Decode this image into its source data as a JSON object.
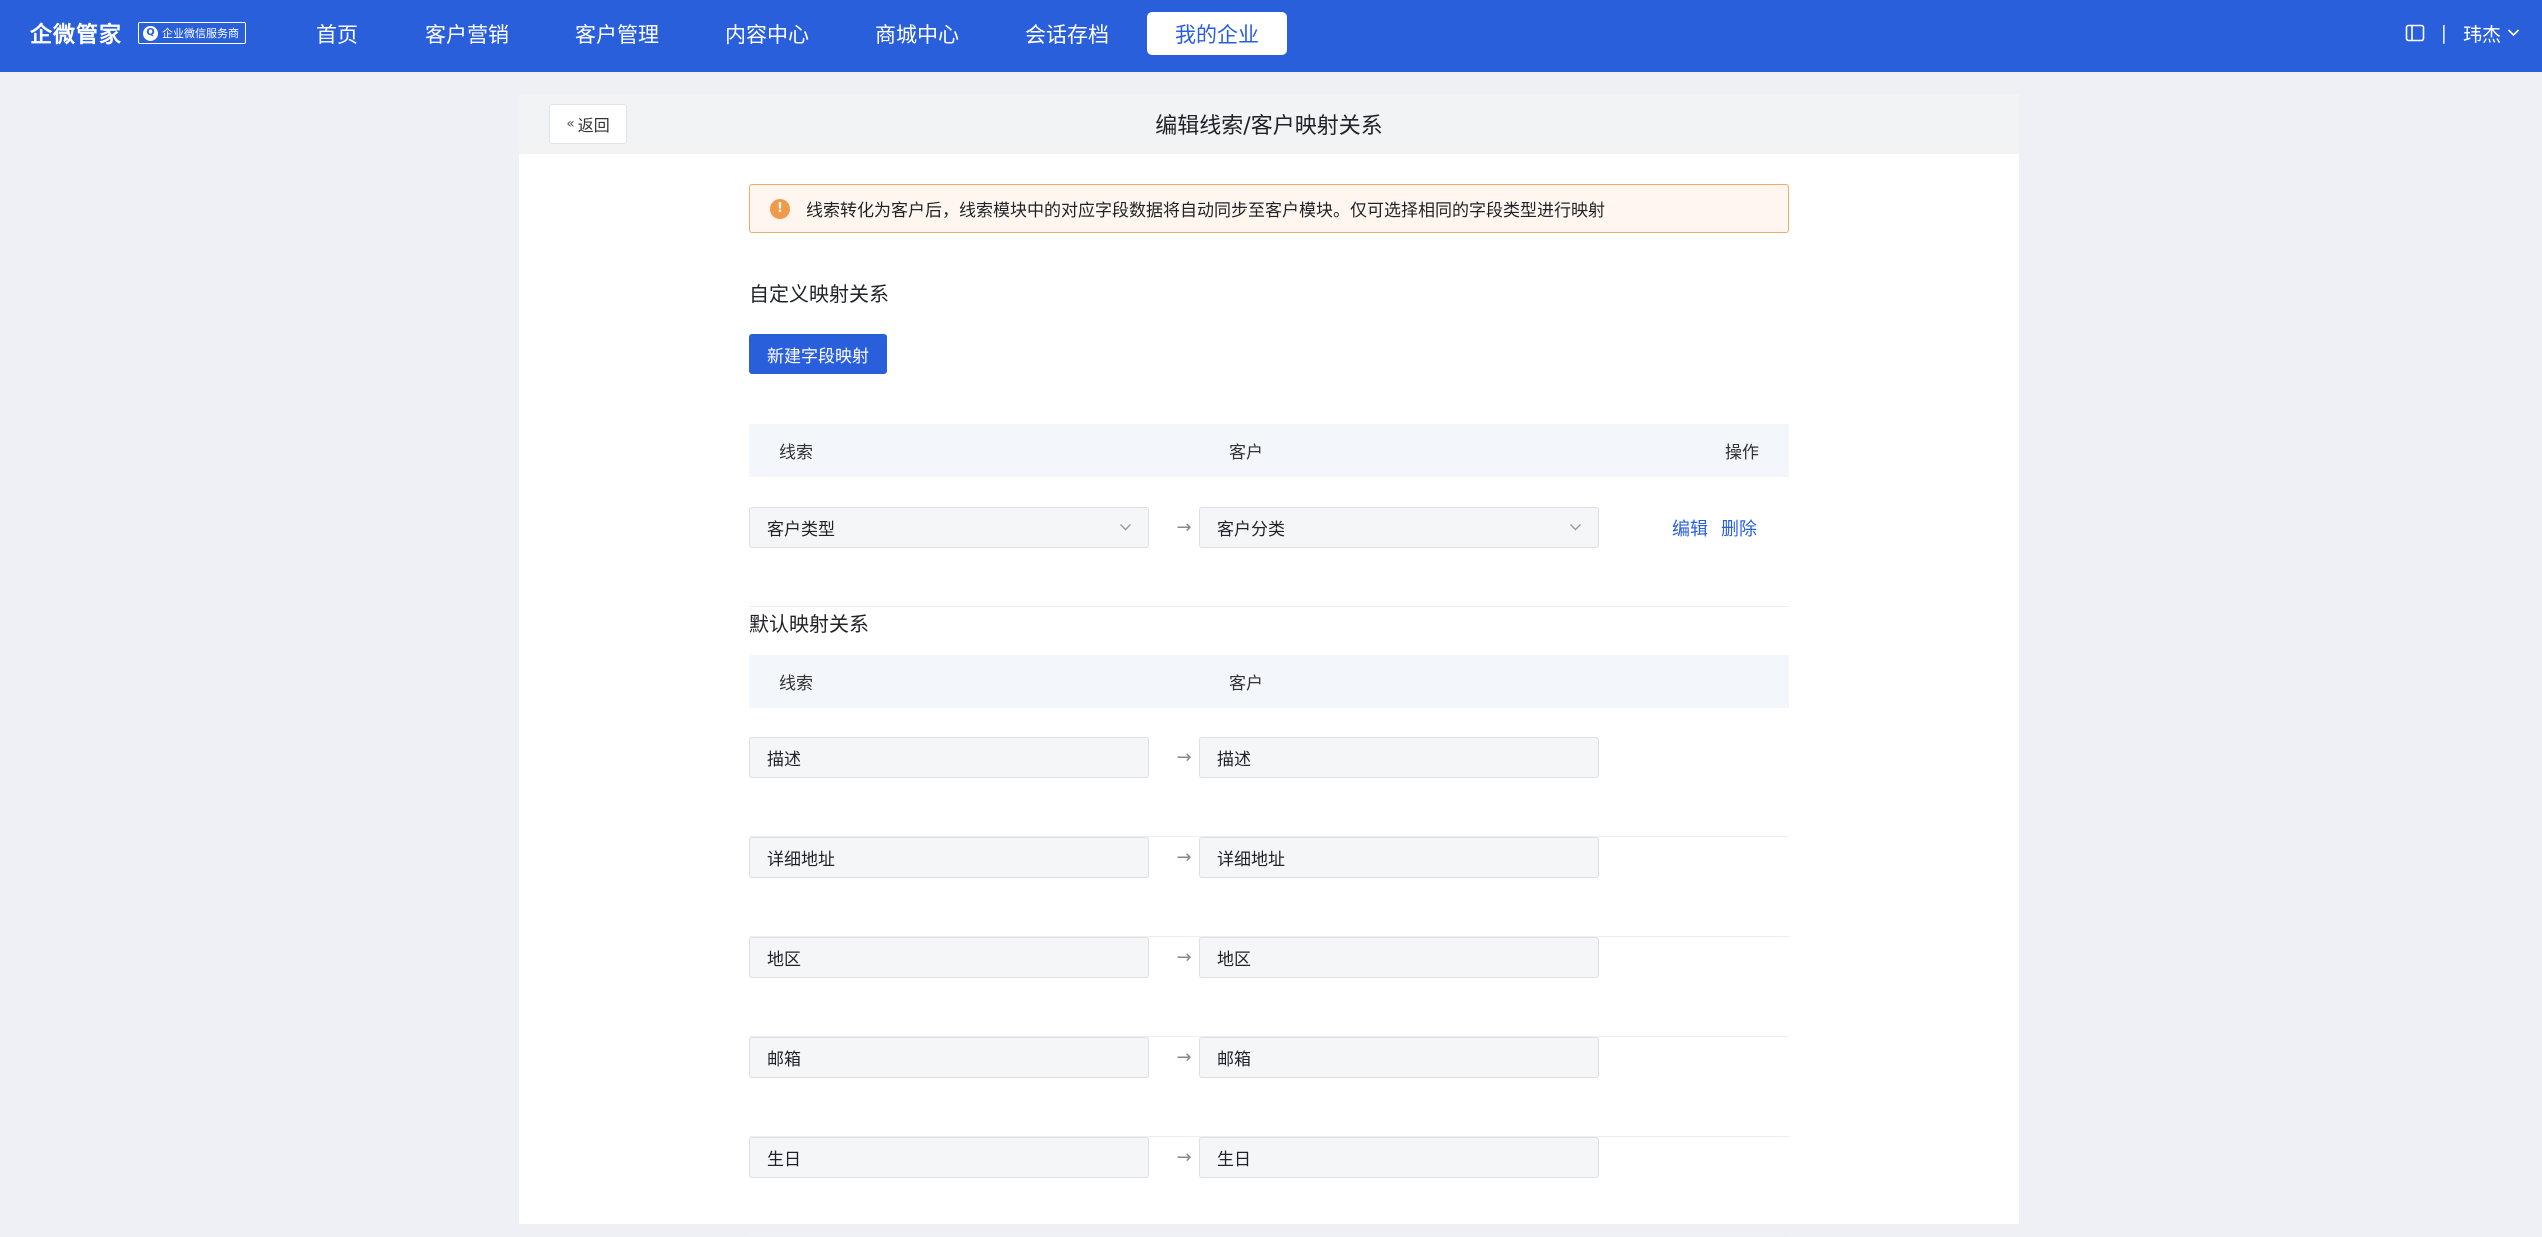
{
  "brand": {
    "name": "企微管家",
    "badge": "企业微信服务商"
  },
  "nav": {
    "items": [
      {
        "label": "首页"
      },
      {
        "label": "客户营销"
      },
      {
        "label": "客户管理"
      },
      {
        "label": "内容中心"
      },
      {
        "label": "商城中心"
      },
      {
        "label": "会话存档"
      },
      {
        "label": "我的企业",
        "active": true
      }
    ]
  },
  "user": {
    "divider": "|",
    "name": "玮杰"
  },
  "header": {
    "back_label": "返回",
    "title": "编辑线索/客户映射关系"
  },
  "alert": {
    "text": "线索转化为客户后，线索模块中的对应字段数据将自动同步至客户模块。仅可选择相同的字段类型进行映射"
  },
  "custom": {
    "title": "自定义映射关系",
    "new_button": "新建字段映射",
    "columns": {
      "lead": "线索",
      "customer": "客户",
      "action": "操作"
    },
    "rows": [
      {
        "lead": "客户类型",
        "customer": "客户分类",
        "edit": "编辑",
        "delete": "删除"
      }
    ]
  },
  "default": {
    "title": "默认映射关系",
    "columns": {
      "lead": "线索",
      "customer": "客户"
    },
    "rows": [
      {
        "lead": "描述",
        "customer": "描述"
      },
      {
        "lead": "详细地址",
        "customer": "详细地址"
      },
      {
        "lead": "地区",
        "customer": "地区"
      },
      {
        "lead": "邮箱",
        "customer": "邮箱"
      },
      {
        "lead": "生日",
        "customer": "生日"
      }
    ]
  },
  "arrow": "→",
  "colors": {
    "primary": "#2a5fdc",
    "warning": "#f19a4a",
    "alert_bg": "#fff7ef"
  }
}
